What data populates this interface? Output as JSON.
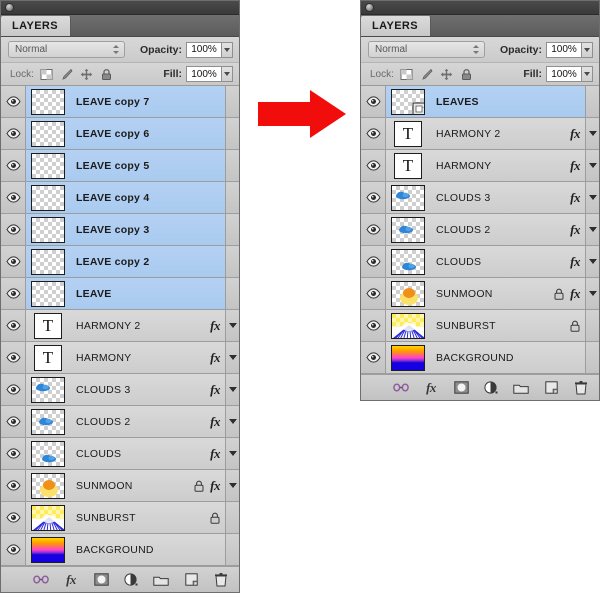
{
  "app": {
    "panel_title": "LAYERS",
    "window_button": "collapse-dot"
  },
  "options": {
    "blend_mode": "Normal",
    "blend_mode_options": [
      "Normal"
    ],
    "opacity_label": "Opacity:",
    "opacity_value": "100%",
    "fill_label": "Fill:",
    "fill_value": "100%",
    "lock_label": "Lock:",
    "lock_icons": [
      "lock-transparency-icon",
      "lock-image-icon",
      "lock-position-icon",
      "lock-all-icon"
    ]
  },
  "bottom_toolbar": {
    "buttons": [
      {
        "name": "link-layers-icon",
        "title": "Link layers"
      },
      {
        "name": "layer-style-fx-icon",
        "title": "Add a layer style"
      },
      {
        "name": "layer-mask-icon",
        "title": "Add layer mask"
      },
      {
        "name": "adjustment-layer-icon",
        "title": "Create new fill or adjustment layer"
      },
      {
        "name": "new-group-icon",
        "title": "Create a new group"
      },
      {
        "name": "new-layer-icon",
        "title": "Create a new layer"
      },
      {
        "name": "delete-layer-icon",
        "title": "Delete layer"
      }
    ]
  },
  "arrow": {
    "name": "red-right-arrow",
    "color": "#f20d0d",
    "direction": "right"
  },
  "panel_left": {
    "title": "LAYERS",
    "layers": [
      {
        "name": "LEAVE copy 7",
        "selected": true,
        "visible": true,
        "thumb": "transparent",
        "fx": false,
        "lock": false,
        "triangle": false,
        "smart": false
      },
      {
        "name": "LEAVE copy 6",
        "selected": true,
        "visible": true,
        "thumb": "transparent",
        "fx": false,
        "lock": false,
        "triangle": false,
        "smart": false
      },
      {
        "name": "LEAVE copy 5",
        "selected": true,
        "visible": true,
        "thumb": "transparent",
        "fx": false,
        "lock": false,
        "triangle": false,
        "smart": false
      },
      {
        "name": "LEAVE copy 4",
        "selected": true,
        "visible": true,
        "thumb": "transparent",
        "fx": false,
        "lock": false,
        "triangle": false,
        "smart": false
      },
      {
        "name": "LEAVE copy 3",
        "selected": true,
        "visible": true,
        "thumb": "transparent",
        "fx": false,
        "lock": false,
        "triangle": false,
        "smart": false
      },
      {
        "name": "LEAVE copy 2",
        "selected": true,
        "visible": true,
        "thumb": "transparent",
        "fx": false,
        "lock": false,
        "triangle": false,
        "smart": false
      },
      {
        "name": "LEAVE",
        "selected": true,
        "visible": true,
        "thumb": "transparent",
        "fx": false,
        "lock": false,
        "triangle": false,
        "smart": false
      },
      {
        "name": "HARMONY 2",
        "selected": false,
        "visible": true,
        "thumb": "text",
        "fx": true,
        "lock": false,
        "triangle": true,
        "smart": false
      },
      {
        "name": "HARMONY",
        "selected": false,
        "visible": true,
        "thumb": "text",
        "fx": true,
        "lock": false,
        "triangle": true,
        "smart": false
      },
      {
        "name": "CLOUDS 3",
        "selected": false,
        "visible": true,
        "thumb": "clouds3",
        "fx": true,
        "lock": false,
        "triangle": true,
        "smart": false
      },
      {
        "name": "CLOUDS 2",
        "selected": false,
        "visible": true,
        "thumb": "clouds2",
        "fx": true,
        "lock": false,
        "triangle": true,
        "smart": false
      },
      {
        "name": "CLOUDS",
        "selected": false,
        "visible": true,
        "thumb": "clouds1",
        "fx": true,
        "lock": false,
        "triangle": true,
        "smart": false
      },
      {
        "name": "SUNMOON",
        "selected": false,
        "visible": true,
        "thumb": "sunmoon",
        "fx": true,
        "lock": true,
        "triangle": true,
        "smart": false
      },
      {
        "name": "SUNBURST",
        "selected": false,
        "visible": true,
        "thumb": "sunburst",
        "fx": false,
        "lock": true,
        "triangle": false,
        "smart": false
      },
      {
        "name": "BACKGROUND",
        "selected": false,
        "visible": true,
        "thumb": "background",
        "fx": false,
        "lock": false,
        "triangle": false,
        "smart": false
      }
    ]
  },
  "panel_right": {
    "title": "LAYERS",
    "layers": [
      {
        "name": "LEAVES",
        "selected": true,
        "visible": true,
        "thumb": "transparent",
        "fx": false,
        "lock": false,
        "triangle": false,
        "smart": true
      },
      {
        "name": "HARMONY 2",
        "selected": false,
        "visible": true,
        "thumb": "text",
        "fx": true,
        "lock": false,
        "triangle": true,
        "smart": false
      },
      {
        "name": "HARMONY",
        "selected": false,
        "visible": true,
        "thumb": "text",
        "fx": true,
        "lock": false,
        "triangle": true,
        "smart": false
      },
      {
        "name": "CLOUDS 3",
        "selected": false,
        "visible": true,
        "thumb": "clouds3",
        "fx": true,
        "lock": false,
        "triangle": true,
        "smart": false
      },
      {
        "name": "CLOUDS 2",
        "selected": false,
        "visible": true,
        "thumb": "clouds2",
        "fx": true,
        "lock": false,
        "triangle": true,
        "smart": false
      },
      {
        "name": "CLOUDS",
        "selected": false,
        "visible": true,
        "thumb": "clouds1",
        "fx": true,
        "lock": false,
        "triangle": true,
        "smart": false
      },
      {
        "name": "SUNMOON",
        "selected": false,
        "visible": true,
        "thumb": "sunmoon",
        "fx": true,
        "lock": true,
        "triangle": true,
        "smart": false
      },
      {
        "name": "SUNBURST",
        "selected": false,
        "visible": true,
        "thumb": "sunburst",
        "fx": false,
        "lock": true,
        "triangle": false,
        "smart": false
      },
      {
        "name": "BACKGROUND",
        "selected": false,
        "visible": true,
        "thumb": "background",
        "fx": false,
        "lock": false,
        "triangle": false,
        "smart": false
      }
    ]
  },
  "colors": {
    "selection_blue": "#aecdf1",
    "panel_gray": "#d4d4d4",
    "arrow_red": "#f20d0d",
    "cloud_blue": "#2e86d8",
    "sun_orange": "#f0901a"
  }
}
